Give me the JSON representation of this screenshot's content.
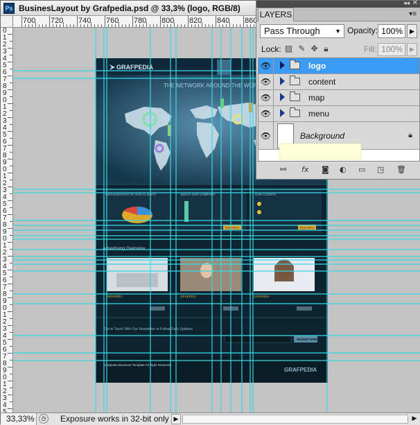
{
  "window": {
    "title": "BusinesLayout by Grafpedia.psd @ 33,3% (logo, RGB/8)",
    "app_icon": "Ps"
  },
  "ruler": {
    "h_labels": [
      "700",
      "720",
      "740",
      "760",
      "780",
      "800",
      "820",
      "840",
      "860"
    ],
    "v_labels": [
      "0",
      "1",
      "2",
      "3",
      "4",
      "5",
      "6",
      "7",
      "8",
      "9",
      "10",
      "11",
      "12",
      "13",
      "14",
      "15",
      "16",
      "17",
      "18",
      "19",
      "20",
      "21",
      "22",
      "23",
      "24",
      "25",
      "26",
      "27",
      "28",
      "29",
      "30",
      "31",
      "32",
      "33",
      "34",
      "35",
      "36",
      "37",
      "38",
      "39",
      "40",
      "41",
      "42",
      "43",
      "44",
      "45",
      "46",
      "47",
      "48",
      "49",
      "50",
      "51",
      "52",
      "53",
      "54",
      "55"
    ]
  },
  "artboard": {
    "brand": "GRAFPEDIA",
    "headline": "THE NETWORK AROUND THE WORLD",
    "sections": [
      "ORGANIZATION OF OUR CLIENTS",
      "ABOUT OUR COMPANY",
      "OUR CLIENTS"
    ],
    "read_more": "Read More",
    "overview_title": "Advertising Overview",
    "dates": [
      "13/12/2012",
      "12/13/2012",
      "12/11/2012"
    ],
    "newsletter": "Get in Touch With Our Newsletter to Follow Daily Updates",
    "signup": "SIGNUP NOW",
    "footer": "Grafpedia Business Template All Right Reserved"
  },
  "layers_panel": {
    "tab": "LAYERS",
    "blend_mode": "Pass Through",
    "opacity_label": "Opacity:",
    "opacity": "100%",
    "lock_label": "Lock:",
    "fill_label": "Fill:",
    "fill": "100%",
    "layers": [
      {
        "name": "logo",
        "type": "group",
        "selected": true
      },
      {
        "name": "content",
        "type": "group",
        "selected": false
      },
      {
        "name": "map",
        "type": "group",
        "selected": false
      },
      {
        "name": "menu",
        "type": "group",
        "selected": false
      }
    ],
    "background_layer": "Background"
  },
  "status": {
    "zoom": "33,33%",
    "info": "Exposure works in 32-bit only"
  },
  "colors": {
    "guide": "#38d8e6",
    "selection": "#3c9bf5",
    "artboard_bg": "#0d2430"
  }
}
